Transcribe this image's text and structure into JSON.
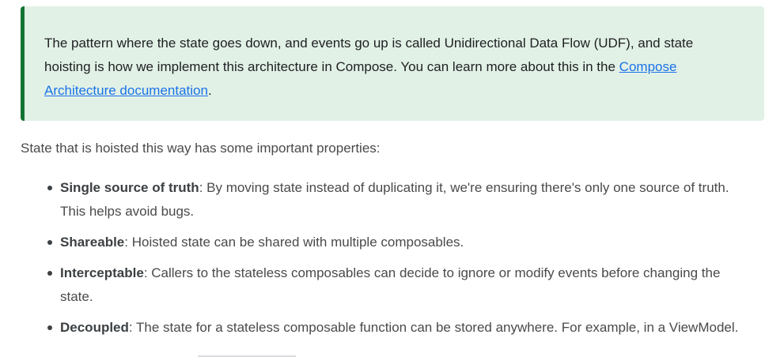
{
  "note": {
    "text_before": "The pattern where the state goes down, and events go up is called Unidirectional Data Flow (UDF), and state hoisting is how we implement this architecture in Compose. You can learn more about this in the ",
    "link_text": "Compose Architecture documentation",
    "text_after": "."
  },
  "intro": "State that is hoisted this way has some important properties:",
  "properties": [
    {
      "term": "Single source of truth",
      "description": ": By moving state instead of duplicating it, we're ensuring there's only one source of truth. This helps avoid bugs."
    },
    {
      "term": "Shareable",
      "description": ": Hoisted state can be shared with multiple composables."
    },
    {
      "term": "Interceptable",
      "description": ": Callers to the stateless composables can decide to ignore or modify events before changing the state."
    },
    {
      "term": "Decoupled",
      "description": ": The state for a stateless composable function can be stored anywhere. For example, in a ViewModel."
    }
  ],
  "colors": {
    "note_background": "#e2f1e6",
    "note_border": "#137333",
    "link": "#1a73e8"
  }
}
